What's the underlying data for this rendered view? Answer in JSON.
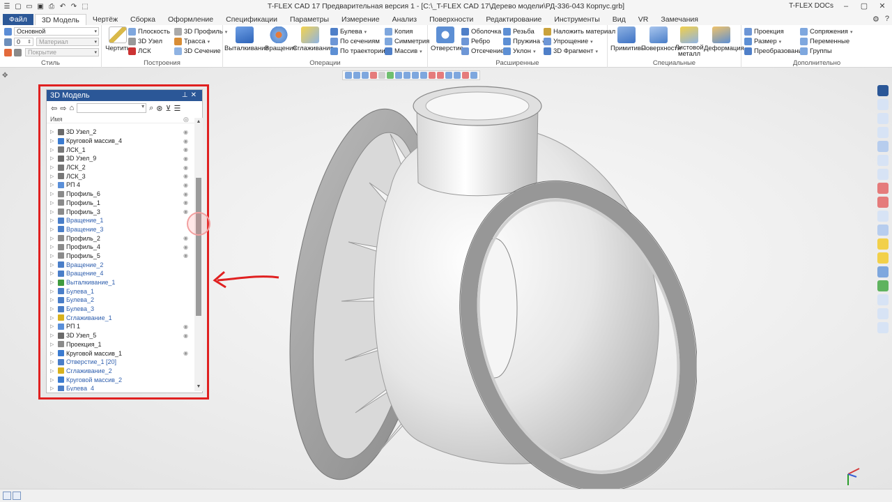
{
  "window": {
    "title": "T-FLEX CAD 17 Предварительная версия 1 - [C:\\_T-FLEX CAD 17\\Дерево модели\\РД-336-043 Корпус.grb]",
    "docs_label": "T-FLEX DOCs",
    "help": "?"
  },
  "tabs": [
    "Файл",
    "3D Модель",
    "Чертёж",
    "Сборка",
    "Оформление",
    "Спецификации",
    "Параметры",
    "Измерение",
    "Анализ",
    "Поверхности",
    "Редактирование",
    "Инструменты",
    "Вид",
    "VR",
    "Замечания"
  ],
  "style_group": {
    "label": "Стиль",
    "layer": "Основной",
    "level": "0",
    "material": "Материал",
    "coating": "Покрытие"
  },
  "build_group": {
    "label": "Построения",
    "draw": "Чертить",
    "plane": "Плоскость",
    "node3d": "3D Узел",
    "lsk": "ЛСК",
    "profile3d": "3D Профиль",
    "path": "Трасса",
    "section3d": "3D Сечение"
  },
  "ops_group": {
    "label": "Операции",
    "extrude": "Выталкивание",
    "rotate": "Вращение",
    "smooth": "Сглаживание",
    "boolean": "Булева",
    "by_sections": "По сечениям",
    "by_path": "По траектории",
    "copy": "Копия",
    "symmetry": "Симметрия",
    "array": "Массив"
  },
  "ext_group": {
    "label": "Расширенные",
    "hole": "Отверстие",
    "shell": "Оболочка",
    "rib": "Ребро",
    "cut": "Отсечение",
    "thread": "Резьба",
    "spring": "Пружина",
    "draft": "Уклон",
    "apply_material": "Наложить материал",
    "simplify": "Упрощение",
    "fragment3d": "3D Фрагмент"
  },
  "special_group": {
    "label": "Специальные",
    "primitives": "Примитивы",
    "surfaces": "Поверхности",
    "sheet_metal_1": "Листовой",
    "sheet_metal_2": "металл",
    "deform": "Деформация"
  },
  "extra_group": {
    "label": "Дополнительно",
    "projection": "Проекция",
    "dimension": "Размер",
    "transform": "Преобразование",
    "mates": "Сопряжения",
    "variables": "Переменные",
    "groups": "Группы"
  },
  "panel": {
    "title": "3D Модель",
    "column": "Имя",
    "items": [
      {
        "label": "3D Узел_2",
        "op": false,
        "eye": true,
        "color": "#6a6a6a"
      },
      {
        "label": "Круговой массив_4",
        "op": false,
        "eye": true,
        "color": "#3b7bd0"
      },
      {
        "label": "ЛСК_1",
        "op": false,
        "eye": true,
        "color": "#777777"
      },
      {
        "label": "3D Узел_9",
        "op": false,
        "eye": true,
        "color": "#6a6a6a"
      },
      {
        "label": "ЛСК_2",
        "op": false,
        "eye": true,
        "color": "#777777"
      },
      {
        "label": "ЛСК_3",
        "op": false,
        "eye": true,
        "color": "#777777"
      },
      {
        "label": "РП 4",
        "op": false,
        "eye": true,
        "color": "#5a8fd8"
      },
      {
        "label": "Профиль_6",
        "op": false,
        "eye": true,
        "color": "#8a8a8a"
      },
      {
        "label": "Профиль_1",
        "op": false,
        "eye": true,
        "color": "#8a8a8a"
      },
      {
        "label": "Профиль_3",
        "op": false,
        "eye": true,
        "color": "#8a8a8a"
      },
      {
        "label": "Вращение_1",
        "op": true,
        "eye": false,
        "color": "#4a7ec8"
      },
      {
        "label": "Вращение_3",
        "op": true,
        "eye": false,
        "color": "#4a7ec8"
      },
      {
        "label": "Профиль_2",
        "op": false,
        "eye": true,
        "color": "#8a8a8a"
      },
      {
        "label": "Профиль_4",
        "op": false,
        "eye": true,
        "color": "#8a8a8a"
      },
      {
        "label": "Профиль_5",
        "op": false,
        "eye": true,
        "color": "#8a8a8a"
      },
      {
        "label": "Вращение_2",
        "op": true,
        "eye": false,
        "color": "#4a7ec8"
      },
      {
        "label": "Вращение_4",
        "op": true,
        "eye": false,
        "color": "#4a7ec8"
      },
      {
        "label": "Выталкивание_1",
        "op": true,
        "eye": false,
        "color": "#3f9a3f"
      },
      {
        "label": "Булева_1",
        "op": true,
        "eye": false,
        "color": "#4a7ec8"
      },
      {
        "label": "Булева_2",
        "op": true,
        "eye": false,
        "color": "#4a7ec8"
      },
      {
        "label": "Булева_3",
        "op": true,
        "eye": false,
        "color": "#4a7ec8"
      },
      {
        "label": "Сглаживание_1",
        "op": true,
        "eye": false,
        "color": "#d8b21e"
      },
      {
        "label": "РП 1",
        "op": false,
        "eye": true,
        "color": "#5a8fd8"
      },
      {
        "label": "3D Узел_5",
        "op": false,
        "eye": true,
        "color": "#6a6a6a"
      },
      {
        "label": "Проекция_1",
        "op": false,
        "eye": false,
        "color": "#8a8a8a"
      },
      {
        "label": "Круговой массив_1",
        "op": false,
        "eye": true,
        "color": "#3b7bd0"
      },
      {
        "label": "Отверстие_1 [20]",
        "op": true,
        "eye": false,
        "color": "#4a7ec8"
      },
      {
        "label": "Сглаживание_2",
        "op": true,
        "eye": false,
        "color": "#d8b21e"
      },
      {
        "label": "Круговой массив_2",
        "op": true,
        "eye": false,
        "color": "#3b7bd0"
      },
      {
        "label": "Булева_4",
        "op": true,
        "eye": false,
        "color": "#4a7ec8"
      }
    ]
  },
  "colors": {
    "accent": "#2b5797",
    "highlight": "#e02020",
    "operation_text": "#2f5fae"
  }
}
